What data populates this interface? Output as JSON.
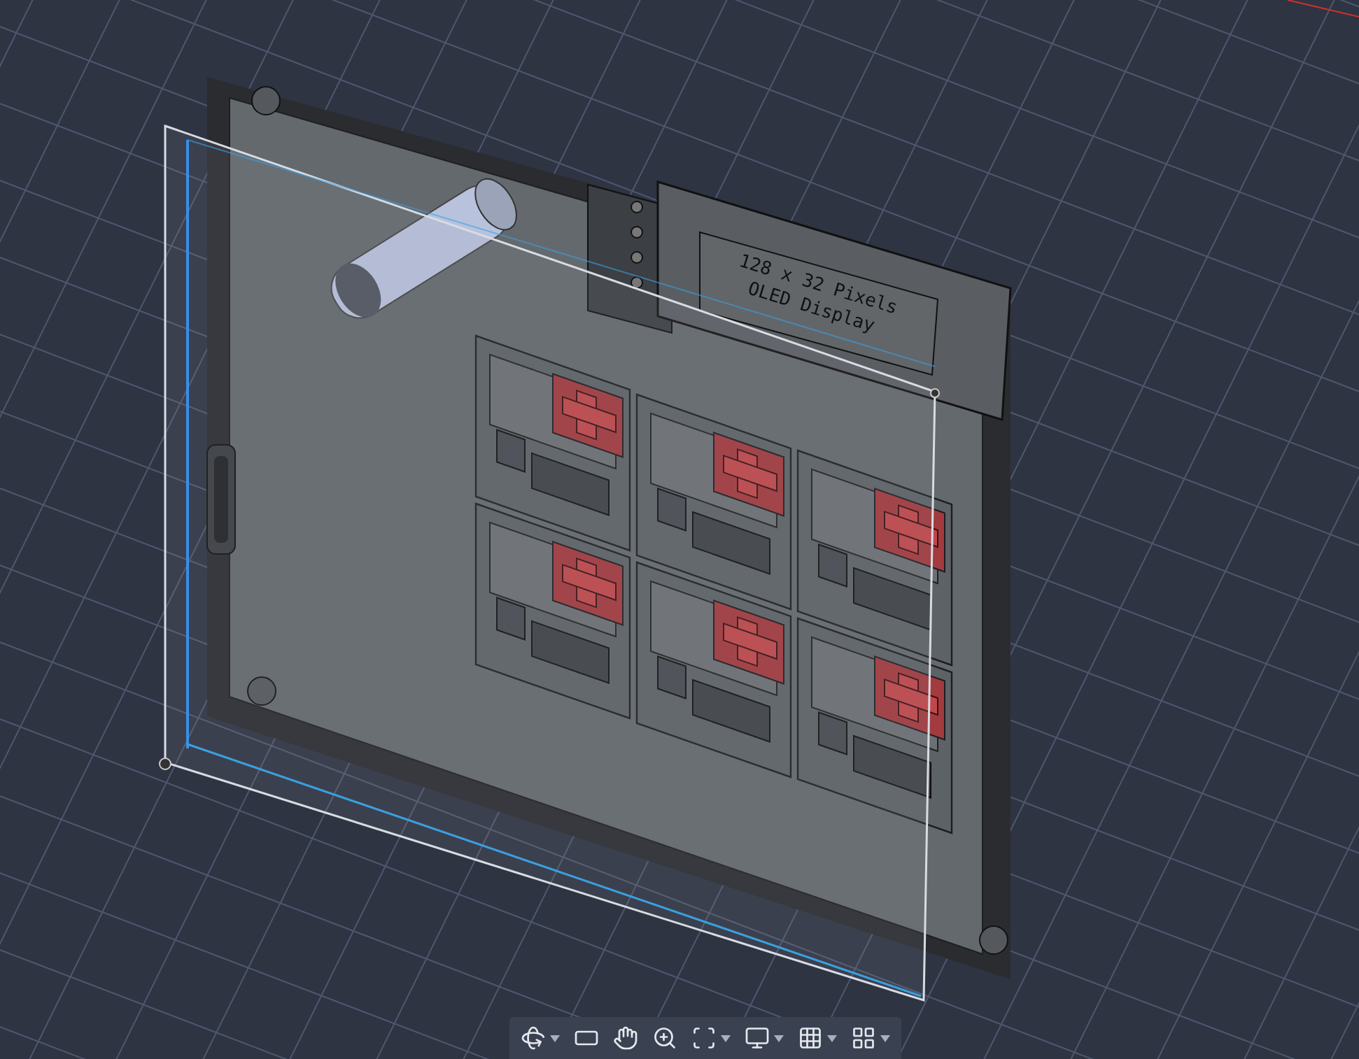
{
  "model": {
    "display_label": [
      "128 x 32 Pixels",
      "OLED Display"
    ]
  },
  "toolbar": {
    "tools": [
      {
        "kind": "orbit",
        "has_menu": true
      },
      {
        "kind": "look-at",
        "has_menu": false
      },
      {
        "kind": "pan",
        "has_menu": false
      },
      {
        "kind": "zoom",
        "has_menu": false
      },
      {
        "kind": "fit",
        "has_menu": true
      },
      {
        "kind": "display",
        "has_menu": true
      },
      {
        "kind": "grid",
        "has_menu": true
      },
      {
        "kind": "viewports",
        "has_menu": true
      }
    ]
  }
}
